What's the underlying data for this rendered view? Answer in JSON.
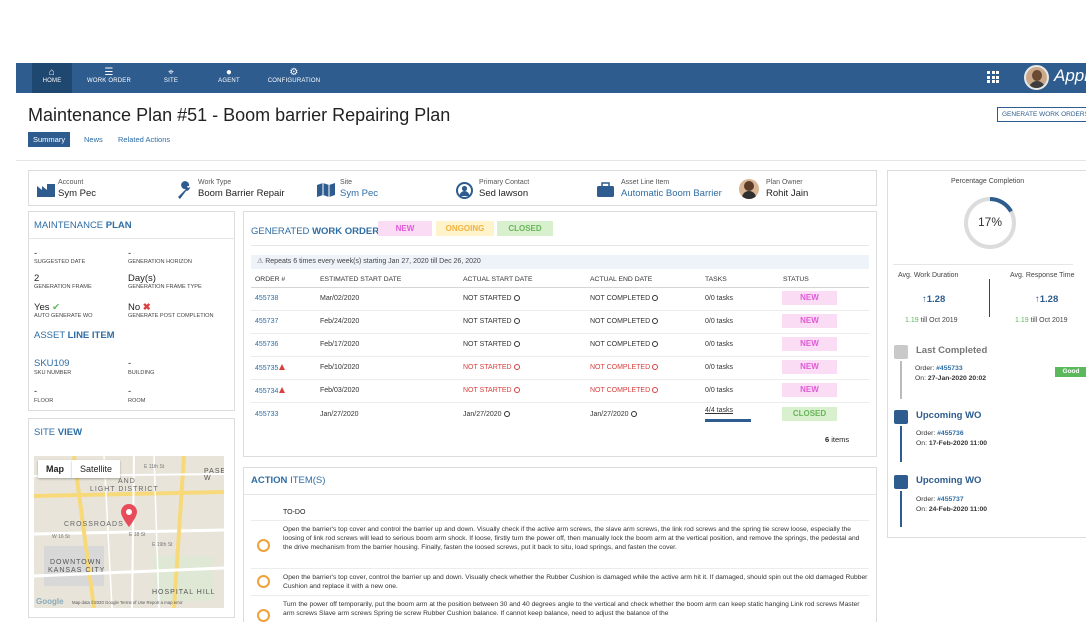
{
  "nav": {
    "items": [
      {
        "label": "HOME",
        "icon": "home-icon"
      },
      {
        "label": "WORK ORDER",
        "icon": "work-order-icon"
      },
      {
        "label": "SITE",
        "icon": "site-pin-icon"
      },
      {
        "label": "AGENT",
        "icon": "agent-icon"
      },
      {
        "label": "CONFIGURATION",
        "icon": "configuration-icon"
      }
    ],
    "brand": "Appia"
  },
  "page": {
    "title": "Maintenance Plan #51 - Boom barrier Repairing Plan",
    "generate_button": "GENERATE WORK ORDERS",
    "tabs": [
      "Summary",
      "News",
      "Related Actions"
    ]
  },
  "overview": {
    "account_label": "Account",
    "account_value": "Sym Pec",
    "work_type_label": "Work Type",
    "work_type_value": "Boom Barrier Repair",
    "site_label": "Site",
    "site_value": "Sym Pec",
    "contact_label": "Primary Contact",
    "contact_value": "Sed lawson",
    "asset_label": "Asset Line Item",
    "asset_value": "Automatic Boom Barrier",
    "owner_label": "Plan Owner",
    "owner_value": "Rohit Jain"
  },
  "maintenance_plan": {
    "title_prefix": "MAINTENANCE ",
    "title_bold": "PLAN",
    "suggested_date_value": "-",
    "suggested_date_label": "SUGGESTED DATE",
    "generation_horizon_value": "-",
    "generation_horizon_label": "GENERATION HORIZON",
    "generation_frame_value": "2",
    "generation_frame_label": "GENERATION FRAME",
    "frame_type_value": "Day(s)",
    "frame_type_label": "GENERATION FRAME TYPE",
    "auto_generate_value": "Yes",
    "auto_generate_label": "AUTO GENERATE WO",
    "post_completion_value": "No",
    "post_completion_label": "GENERATE POST COMPLETION"
  },
  "asset_line_item": {
    "title_prefix": "ASSET ",
    "title_bold": "LINE ITEM",
    "sku_value": "SKU109",
    "sku_label": "SKU NUMBER",
    "building_value": "-",
    "building_label": "BUILDING",
    "floor_value": "-",
    "floor_label": "FLOOR",
    "room_value": "-",
    "room_label": "ROOM"
  },
  "site_view": {
    "title_prefix": "SITE ",
    "title_bold": "VIEW",
    "map_tab": "Map",
    "satellite_tab": "Satellite",
    "places": [
      "PASEO W",
      "AND",
      "LIGHT DISTRICT",
      "CROSSROADS",
      "DOWNTOWN",
      "KANSAS CITY",
      "HOSPITAL HILL",
      "E 11th St",
      "W 16 St",
      "E 19th St",
      "E 18 St"
    ],
    "attribution": "Map data ©2020 Google   Terms of Use   Report a map error"
  },
  "work_orders": {
    "title_prefix": "GENERATED ",
    "title_bold": "WORK ORDERS",
    "filters": [
      "NEW",
      "ONGOING",
      "CLOSED"
    ],
    "banner": "Repeats 6 times every week(s) starting Jan 27, 2020 till Dec 26, 2020",
    "columns": [
      "ORDER #",
      "ESTIMATED START DATE",
      "ACTUAL START DATE",
      "ACTUAL END DATE",
      "TASKS",
      "STATUS"
    ],
    "rows": [
      {
        "order": "455738",
        "est": "Mar/02/2020",
        "start": "NOT STARTED",
        "end": "NOT COMPLETED",
        "tasks": "0/0  tasks",
        "status": "NEW"
      },
      {
        "order": "455737",
        "est": "Feb/24/2020",
        "start": "NOT STARTED",
        "end": "NOT COMPLETED",
        "tasks": "0/0  tasks",
        "status": "NEW"
      },
      {
        "order": "455736",
        "est": "Feb/17/2020",
        "start": "NOT STARTED",
        "end": "NOT COMPLETED",
        "tasks": "0/0  tasks",
        "status": "NEW"
      },
      {
        "order": "455735",
        "est": "Feb/10/2020",
        "start": "NOT STARTED",
        "end": "NOT COMPLETED",
        "tasks": "0/0  tasks",
        "status": "NEW"
      },
      {
        "order": "455734",
        "est": "Feb/03/2020",
        "start": "NOT STARTED",
        "end": "NOT COMPLETED",
        "tasks": "0/0  tasks",
        "status": "NEW"
      },
      {
        "order": "455733",
        "est": "Jan/27/2020",
        "start": "Jan/27/2020",
        "end": "Jan/27/2020",
        "tasks": "4/4  tasks",
        "status": "CLOSED"
      }
    ],
    "item_count": "6",
    "item_suffix": " items"
  },
  "action_items": {
    "title_bold": "ACTION ",
    "title_rest": "ITEM(S)",
    "column": "TO-DO",
    "items": [
      "Open the barrier's top cover and control the barrier up and down. Visually check if the active arm screws, the slave arm screws, the link rod screws and the spring tie screw loose, especially the loosing of link rod screws will lead to serious boom arm shock. If loose, firstly turn the power off, then manually lock the boom arm at the vertical position, and remove the springs, the pedestal and the drive mechanism from the barrier housing. Finally, fasten the loosed screws, put it back to situ, load springs, and fasten the cover.",
      "Open the barrier's top cover, control the barrier up and down. Visually check whether the Rubber Cushion is damaged while the active arm hit it. If damaged, should spin out the old damaged Rubber Cushion and replace it with a new one.",
      "Turn the power off temporarily, put the boom arm at the position between 30 and 40 degrees angle to the vertical and check whether the boom arm can keep static hanging Link rod screws Master arm screws Slave arm screws Spring tie screw Rubber Cushion balance. If cannot keep balance, need to adjust the balance of the"
    ]
  },
  "completion": {
    "title": "Percentage Completion",
    "value": "17%",
    "percent": 17,
    "avg_work_label": "Avg. Work Duration",
    "avg_work_value": "1.28",
    "avg_work_prev": "1.19",
    "avg_work_prev_suffix": " till Oct 2019",
    "avg_resp_label": "Avg. Response Time",
    "avg_resp_value": "1.28",
    "avg_resp_prev": "1.19",
    "avg_resp_prev_suffix": " till Oct 2019"
  },
  "timeline": {
    "last": {
      "title": "Last Completed",
      "order_label": "Order: ",
      "order": "#455733",
      "on_label": "On: ",
      "on": "27-Jan-2020 20:02",
      "badge": "Good"
    },
    "upcoming1": {
      "title": "Upcoming WO",
      "order_label": "Order: ",
      "order": "#455736",
      "on_label": "On: ",
      "on": "17-Feb-2020 11:00"
    },
    "upcoming2": {
      "title": "Upcoming WO",
      "order_label": "Order: ",
      "order": "#455737",
      "on_label": "On: ",
      "on": "24-Feb-2020 11:00"
    }
  },
  "colors": {
    "nav": "#2e5c8f",
    "link": "#2e6da4",
    "new": "#e05ad7",
    "ongoing": "#f0b340",
    "closed": "#69b559",
    "danger": "#d94040"
  }
}
